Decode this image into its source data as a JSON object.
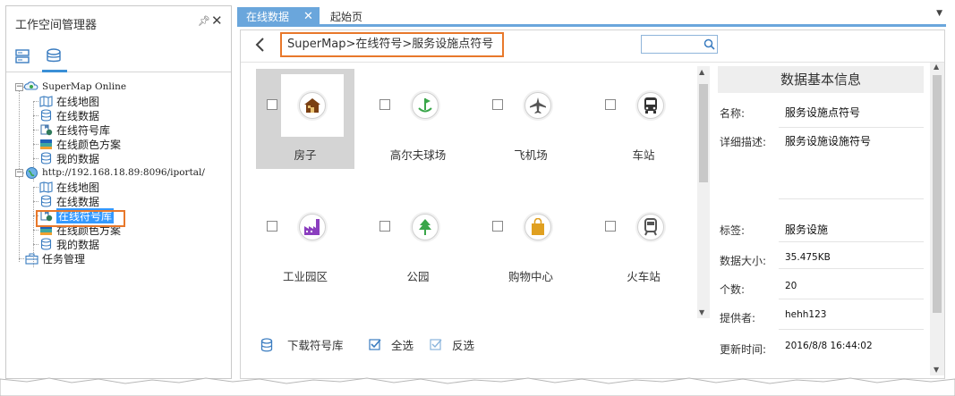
{
  "left_panel": {
    "title": "工作空间管理器",
    "pin_icon": "pin-icon",
    "close_icon": "close-icon",
    "tree": [
      {
        "label": "SuperMap Online",
        "icon": "cloud-globe-icon"
      },
      {
        "label": "在线地图",
        "icon": "map-icon"
      },
      {
        "label": "在线数据",
        "icon": "database-icon"
      },
      {
        "label": "在线符号库",
        "icon": "symbol-library-icon"
      },
      {
        "label": "在线颜色方案",
        "icon": "color-scheme-icon"
      },
      {
        "label": "我的数据",
        "icon": "database-icon"
      },
      {
        "label": "http://192.168.18.89:8096/iportal/",
        "icon": "globe-icon"
      },
      {
        "label": "在线地图",
        "icon": "map-icon"
      },
      {
        "label": "在线数据",
        "icon": "database-icon"
      },
      {
        "label": "在线符号库",
        "icon": "symbol-library-icon"
      },
      {
        "label": "在线颜色方案",
        "icon": "color-scheme-icon"
      },
      {
        "label": "我的数据",
        "icon": "database-icon"
      },
      {
        "label": "任务管理",
        "icon": "briefcase-icon"
      }
    ]
  },
  "tabs": [
    {
      "label": "在线数据",
      "active": true
    },
    {
      "label": "起始页",
      "active": false
    }
  ],
  "toolbar": {
    "breadcrumb": "SuperMap>在线符号>服务设施点符号",
    "search_placeholder": ""
  },
  "symbols": [
    {
      "name": "房子",
      "icon": "house-icon",
      "color": "#7a3f12",
      "selected": true
    },
    {
      "name": "高尔夫球场",
      "icon": "golf-icon",
      "color": "#3aa64a",
      "selected": false
    },
    {
      "name": "飞机场",
      "icon": "airplane-icon",
      "color": "#555555",
      "selected": false
    },
    {
      "name": "车站",
      "icon": "bus-icon",
      "color": "#333333",
      "selected": false
    },
    {
      "name": "工业园区",
      "icon": "factory-icon",
      "color": "#8b3fbf",
      "selected": false
    },
    {
      "name": "公园",
      "icon": "tree-icon",
      "color": "#3aa64a",
      "selected": false
    },
    {
      "name": "购物中心",
      "icon": "shopping-bag-icon",
      "color": "#e0a020",
      "selected": false
    },
    {
      "name": "火车站",
      "icon": "train-icon",
      "color": "#555555",
      "selected": false
    }
  ],
  "actions": {
    "download": "下载符号库",
    "select_all": "全选",
    "invert": "反选"
  },
  "info": {
    "title": "数据基本信息",
    "rows": [
      {
        "label": "名称:",
        "value": "服务设施点符号"
      },
      {
        "label": "详细描述:",
        "value": "服务设施设施符号"
      },
      {
        "label": "标签:",
        "value": "服务设施"
      },
      {
        "label": "数据大小:",
        "value": "35.475KB"
      },
      {
        "label": "个数:",
        "value": "20"
      },
      {
        "label": "提供者:",
        "value": "hehh123"
      },
      {
        "label": "更新时间:",
        "value": "2016/8/8 16:44:02"
      }
    ]
  },
  "colors": {
    "accent_blue": "#6aa6dc",
    "highlight_orange": "#e8782b",
    "selection_blue": "#3399ff"
  }
}
